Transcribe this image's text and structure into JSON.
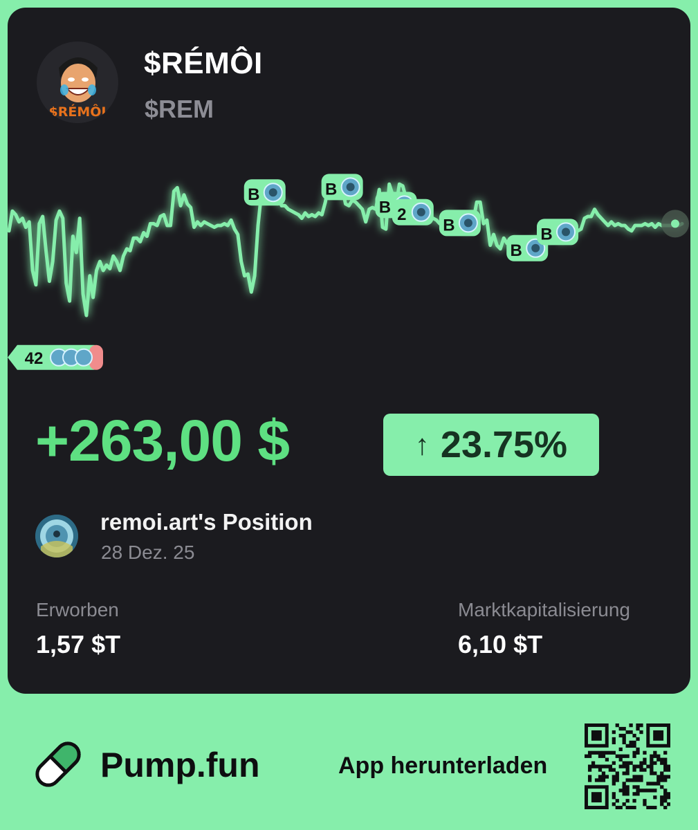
{
  "token": {
    "name": "$RÉMÔI",
    "ticker": "$REM",
    "avatar_text": "$RÉMÔI"
  },
  "chart_data": {
    "type": "line",
    "x": [
      0,
      5,
      10,
      15,
      20,
      25,
      30,
      35,
      40,
      45,
      50,
      55,
      60,
      65,
      70,
      75,
      80,
      85,
      90,
      95,
      100,
      105,
      110,
      115,
      120,
      125,
      130,
      135,
      140,
      145,
      150,
      155,
      160,
      165,
      170,
      175,
      180,
      185,
      190,
      195,
      200,
      205,
      210,
      215,
      220,
      225,
      230,
      235,
      240,
      245,
      250,
      255,
      260,
      265,
      270,
      275,
      280,
      285,
      290,
      295,
      300,
      305,
      310,
      315,
      320,
      325,
      330,
      335,
      340,
      345,
      350,
      355,
      360,
      365,
      370,
      375,
      380,
      385,
      390,
      395,
      400,
      405,
      410,
      415,
      420,
      425,
      430,
      435,
      440,
      445,
      450,
      455,
      460,
      465,
      470,
      475,
      480,
      485,
      490,
      495,
      500,
      505,
      510,
      515,
      520,
      525,
      530,
      535,
      540,
      545,
      550,
      555,
      560,
      565,
      570,
      575,
      580,
      585,
      590,
      595,
      600,
      605,
      610,
      615,
      620,
      625,
      630,
      635,
      640,
      645,
      650,
      655,
      660,
      665,
      670,
      675,
      680,
      685,
      690,
      695,
      700,
      705,
      710,
      715,
      720,
      725,
      730,
      735,
      740,
      745,
      750,
      755,
      760,
      765,
      770,
      775,
      780,
      785,
      790,
      795,
      800,
      805,
      810,
      815,
      820,
      825,
      830,
      835,
      840,
      845,
      850,
      855,
      860,
      865,
      870,
      875,
      880,
      885,
      890,
      895,
      900,
      905,
      910,
      915,
      920,
      925,
      930,
      935,
      940,
      945,
      950,
      955,
      960,
      965,
      970,
      975,
      980,
      985,
      990,
      995,
      1000
    ],
    "y": [
      72,
      83,
      81,
      77,
      79,
      74,
      77,
      50,
      42,
      76,
      80,
      61,
      44,
      55,
      78,
      83,
      79,
      43,
      33,
      69,
      60,
      79,
      37,
      25,
      47,
      35,
      50,
      55,
      50,
      53,
      51,
      58,
      55,
      50,
      58,
      62,
      61,
      68,
      68,
      66,
      71,
      69,
      76,
      76,
      75,
      80,
      81,
      75,
      75,
      94,
      96,
      86,
      92,
      87,
      85,
      74,
      77,
      75,
      77,
      76,
      75,
      74,
      75,
      75,
      76,
      75,
      78,
      73,
      70,
      55,
      47,
      48,
      38,
      47,
      75,
      93,
      93,
      93,
      91,
      90,
      90,
      86,
      86,
      84,
      83,
      82,
      81,
      79,
      82,
      80,
      81,
      80,
      82,
      81,
      88,
      98,
      99,
      98,
      97,
      96,
      87,
      86,
      89,
      88,
      86,
      84,
      77,
      84,
      85,
      84,
      95,
      74,
      73,
      98,
      92,
      86,
      98,
      97,
      90,
      82,
      82,
      81,
      80,
      79,
      79,
      78,
      79,
      78,
      76,
      79,
      79,
      82,
      77,
      79,
      76,
      78,
      72,
      74,
      78,
      88,
      88,
      76,
      78,
      64,
      70,
      64,
      62,
      68,
      65,
      66,
      67,
      61,
      62,
      63,
      62,
      64,
      65,
      67,
      67,
      66,
      72,
      71,
      71,
      71,
      66,
      69,
      68,
      67,
      72,
      72,
      73,
      79,
      80,
      80,
      84,
      81,
      79,
      77,
      75,
      77,
      75,
      76,
      75,
      75,
      73,
      72,
      75,
      75,
      75,
      76,
      75,
      76,
      74,
      76,
      75,
      75,
      75,
      75,
      75,
      75,
      76
    ],
    "markers": [
      {
        "label": "B",
        "at": 380
      },
      {
        "label": "B",
        "at": 495
      },
      {
        "label": "B",
        "at": 575
      },
      {
        "label": "2",
        "at": 600
      },
      {
        "label": "B",
        "at": 670
      },
      {
        "label": "B",
        "at": 770
      },
      {
        "label": "B",
        "at": 815
      }
    ],
    "start_badge": {
      "label": "42"
    },
    "colors": {
      "line": "#86eeab",
      "marker": "#86eeab"
    }
  },
  "position": {
    "pnl": "+263,00 $",
    "change_arrow": "↑",
    "change_pct": "23.75%",
    "owner": "remoi.art's Position",
    "date": "28 Dez. 25"
  },
  "stats": {
    "acquired_label": "Erworben",
    "acquired_value": "1,57 $T",
    "mcap_label": "Marktkapitalisierung",
    "mcap_value": "6,10 $T"
  },
  "footer": {
    "brand": "Pump.fun",
    "download": "App herunterladen"
  },
  "colors": {
    "background": "#86eeab",
    "card": "#1b1b1f",
    "accent": "#5ee082"
  }
}
